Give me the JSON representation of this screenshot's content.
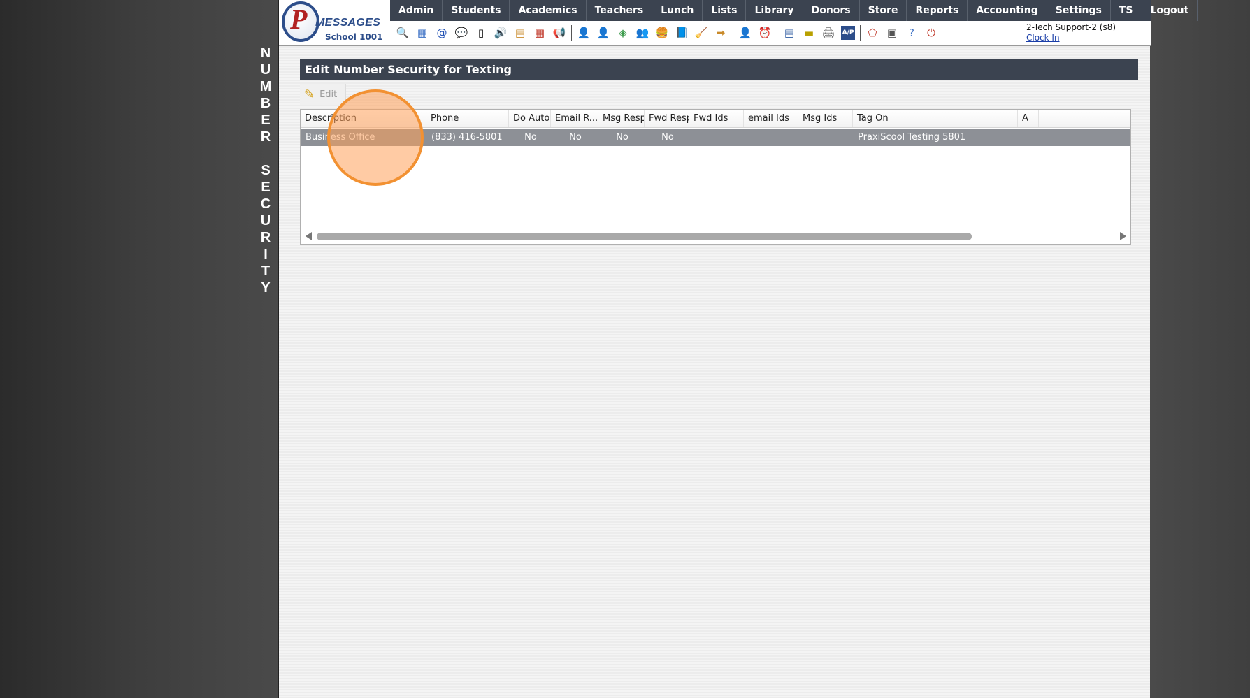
{
  "side_title": {
    "word1": [
      "N",
      "U",
      "M",
      "B",
      "E",
      "R"
    ],
    "word2": [
      "S",
      "E",
      "C",
      "U",
      "R",
      "I",
      "T",
      "Y"
    ]
  },
  "logo": {
    "letter": "P",
    "brand": "MESSAGES",
    "school": "School 1001"
  },
  "nav": [
    "Admin",
    "Students",
    "Academics",
    "Teachers",
    "Lunch",
    "Lists",
    "Library",
    "Donors",
    "Store",
    "Reports",
    "Accounting",
    "Settings",
    "TS",
    "Logout"
  ],
  "toolbar_icons": [
    {
      "name": "search-icon",
      "glyph": "🔍",
      "color": "#3a6fc4"
    },
    {
      "name": "calendar-grid-icon",
      "glyph": "▦",
      "color": "#3a6fc4"
    },
    {
      "name": "email-at-icon",
      "glyph": "@",
      "color": "#1f4fb4"
    },
    {
      "name": "chat-bubbles-icon",
      "glyph": "💬",
      "color": "#2e9e3a"
    },
    {
      "name": "mobile-phone-icon",
      "glyph": "▯",
      "color": "#111111"
    },
    {
      "name": "speaker-icon",
      "glyph": "🔊",
      "color": "#888888"
    },
    {
      "name": "form-icon",
      "glyph": "▤",
      "color": "#c98a2a"
    },
    {
      "name": "calendar-icon",
      "glyph": "▦",
      "color": "#c0392b"
    },
    {
      "name": "megaphone-icon",
      "glyph": "📢",
      "color": "#d4761c"
    },
    {
      "sep": true
    },
    {
      "name": "student-add-icon",
      "glyph": "👤",
      "color": "#c0392b"
    },
    {
      "name": "student-icon",
      "glyph": "👤",
      "color": "#a0522d"
    },
    {
      "name": "money-icon",
      "glyph": "◈",
      "color": "#3a9a4a"
    },
    {
      "name": "group-icon",
      "glyph": "👥",
      "color": "#8e44ad"
    },
    {
      "name": "lunch-icon",
      "glyph": "🍔",
      "color": "#c98a2a"
    },
    {
      "name": "book-icon",
      "glyph": "📘",
      "color": "#2c5aa0"
    },
    {
      "name": "broom-icon",
      "glyph": "🧹",
      "color": "#d4a017"
    },
    {
      "name": "forward-icon",
      "glyph": "➡",
      "color": "#c98a2a"
    },
    {
      "sep": true
    },
    {
      "name": "teacher-icon",
      "glyph": "👤",
      "color": "#555555"
    },
    {
      "name": "clock-icon",
      "glyph": "⏰",
      "color": "#2c5aa0"
    },
    {
      "sep": true
    },
    {
      "name": "report-icon",
      "glyph": "▤",
      "color": "#2c5aa0"
    },
    {
      "name": "card-icon",
      "glyph": "▬",
      "color": "#b8a000"
    },
    {
      "name": "printer-icon",
      "glyph": "🖨",
      "color": "#555555"
    },
    {
      "name": "ap-icon",
      "glyph": "A/P",
      "color": "#2c4d8a"
    },
    {
      "sep": true
    },
    {
      "name": "pdf-icon",
      "glyph": "⬠",
      "color": "#c0392b"
    },
    {
      "name": "cash-register-icon",
      "glyph": "▣",
      "color": "#555555"
    },
    {
      "name": "help-icon",
      "glyph": "?",
      "color": "#3a6fc4"
    },
    {
      "name": "power-icon",
      "glyph": "⏻",
      "color": "#c0392b"
    }
  ],
  "user": {
    "name": "2-Tech Support-2 (s8)",
    "clock_in": "Clock In"
  },
  "panel": {
    "title": "Edit Number Security for Texting",
    "edit_label": "Edit"
  },
  "grid": {
    "columns": [
      "Description",
      "Phone",
      "Do Auto",
      "Email R...",
      "Msg Resp",
      "Fwd Resp",
      "Fwd Ids",
      "email Ids",
      "Msg Ids",
      "Tag On",
      "A"
    ],
    "rows": [
      [
        "Business Office",
        "(833) 416-5801",
        "No",
        "No",
        "No",
        "No",
        "",
        "",
        "",
        "PraxiScool Testing 5801",
        ""
      ]
    ]
  },
  "colors": {
    "nav_bg": "#3b4350",
    "row_selected": "#8d9096",
    "highlight": "#f29132"
  }
}
